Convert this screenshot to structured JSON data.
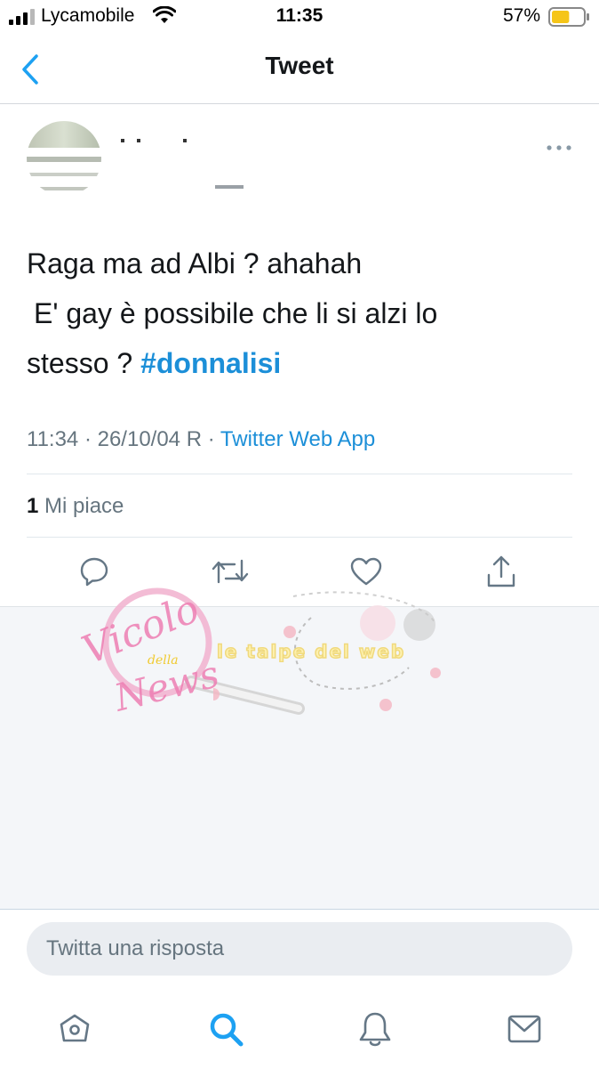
{
  "status_bar": {
    "carrier": "Lycamobile",
    "time": "11:35",
    "battery": "57%",
    "battery_level": 0.57
  },
  "nav": {
    "title": "Tweet"
  },
  "tweet": {
    "text_lines": [
      "Raga ma ad Albi ? ahahah",
      "E' gay è possibile che li si alzi lo",
      "stesso ? "
    ],
    "hashtag": "#donnalisi",
    "timestamp": "11:34 · 26/10/04 R · ",
    "source": "Twitter Web App",
    "likes_count": "1",
    "likes_label": "Mi piace"
  },
  "watermark": {
    "left_text": "Vicolo",
    "left_small": "della",
    "left_text2": "News",
    "right_text": "le talpe del web"
  },
  "reply": {
    "placeholder": "Twitta una risposta"
  },
  "colors": {
    "accent": "#1da1f2",
    "hashtag": "#1c8fd8",
    "muted": "#66757f",
    "battery": "#f5c518"
  },
  "icons": [
    "signal-icon",
    "wifi-icon",
    "battery-icon",
    "back-chevron-icon",
    "more-icon",
    "reply-icon",
    "retweet-icon",
    "like-icon",
    "share-icon",
    "home-icon",
    "search-icon",
    "notifications-icon",
    "messages-icon"
  ]
}
